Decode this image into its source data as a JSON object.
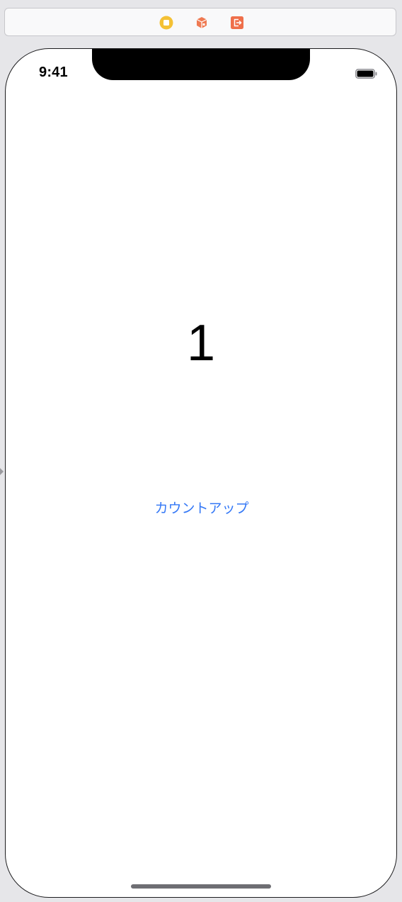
{
  "scene_dock": {
    "icons": [
      "view-controller-icon",
      "first-responder-icon",
      "exit-icon"
    ],
    "colors": {
      "view_controller": "#f4c135",
      "first_responder": "#ef7a52",
      "exit": "#ef6f4a"
    }
  },
  "device": {
    "status_bar": {
      "time": "9:41",
      "battery_icon": "battery-icon"
    }
  },
  "content": {
    "counter_value": "1",
    "countup_button_label": "カウントアップ",
    "accent_color": "#3478f6"
  }
}
